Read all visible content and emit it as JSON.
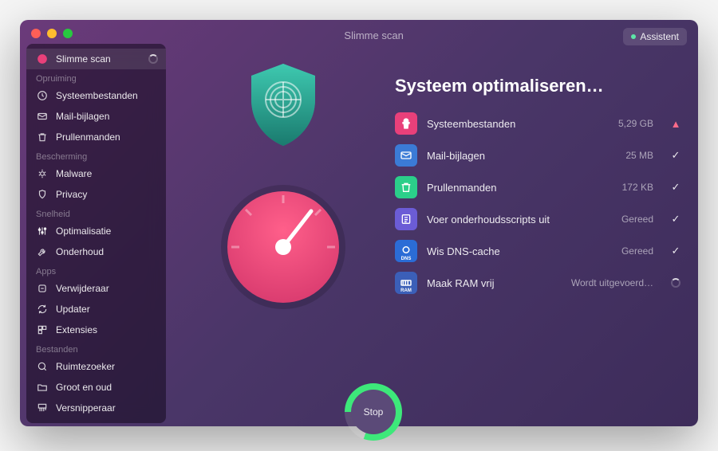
{
  "header": {
    "title": "Slimme scan",
    "assistant_label": "Assistent"
  },
  "sidebar": {
    "active": {
      "label": "Slimme scan"
    },
    "sections": [
      {
        "heading": "Opruiming",
        "items": [
          {
            "label": "Systeembestanden"
          },
          {
            "label": "Mail-bijlagen"
          },
          {
            "label": "Prullenmanden"
          }
        ]
      },
      {
        "heading": "Bescherming",
        "items": [
          {
            "label": "Malware"
          },
          {
            "label": "Privacy"
          }
        ]
      },
      {
        "heading": "Snelheid",
        "items": [
          {
            "label": "Optimalisatie"
          },
          {
            "label": "Onderhoud"
          }
        ]
      },
      {
        "heading": "Apps",
        "items": [
          {
            "label": "Verwijderaar"
          },
          {
            "label": "Updater"
          },
          {
            "label": "Extensies"
          }
        ]
      },
      {
        "heading": "Bestanden",
        "items": [
          {
            "label": "Ruimtezoeker"
          },
          {
            "label": "Groot en oud"
          },
          {
            "label": "Versnipperaar"
          }
        ]
      }
    ]
  },
  "main": {
    "title": "Systeem optimaliseren…",
    "stop_label": "Stop",
    "tasks": [
      {
        "label": "Systeembestanden",
        "value": "5,29 GB",
        "status": "warning",
        "icon_bg": "#e8407a",
        "icon_name": "cleanup-icon"
      },
      {
        "label": "Mail-bijlagen",
        "value": "25 MB",
        "status": "done",
        "icon_bg": "#3b7bd6",
        "icon_name": "mail-attachment-icon"
      },
      {
        "label": "Prullenmanden",
        "value": "172 KB",
        "status": "done",
        "icon_bg": "#2bcf8a",
        "icon_name": "trash-icon"
      },
      {
        "label": "Voer onderhoudsscripts uit",
        "value": "Gereed",
        "status": "done",
        "icon_bg": "#6b5cd6",
        "icon_name": "scripts-icon"
      },
      {
        "label": "Wis DNS-cache",
        "value": "Gereed",
        "status": "done",
        "icon_bg": "#2b6cd6",
        "icon_name": "dns-icon",
        "icon_text": "DNS"
      },
      {
        "label": "Maak RAM vrij",
        "value": "Wordt uitgevoerd…",
        "status": "running",
        "icon_bg": "#3b5fb8",
        "icon_name": "ram-icon",
        "icon_text": "RAM"
      }
    ]
  }
}
